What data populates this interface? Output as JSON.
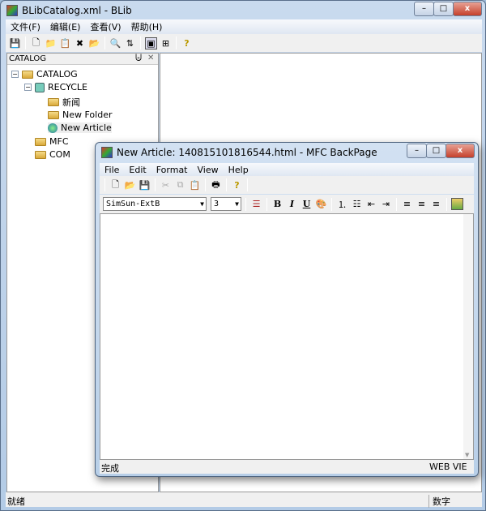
{
  "main": {
    "title": "BLibCatalog.xml - BLib",
    "menu": [
      "文件(F)",
      "编辑(E)",
      "查看(V)",
      "帮助(H)"
    ],
    "catalog_pane": {
      "title": "CATALOG",
      "pin": "⨄",
      "close": "✕"
    },
    "tree": [
      {
        "label": "CATALOG"
      },
      {
        "label": "RECYCLE"
      },
      {
        "label": "新闻"
      },
      {
        "label": "New Folder"
      },
      {
        "label": "New Article"
      },
      {
        "label": "MFC"
      },
      {
        "label": "COM"
      }
    ],
    "status": {
      "left": "就绪",
      "num": "数字"
    }
  },
  "child": {
    "title": "New Article: 140815101816544.html - MFC BackPage",
    "menu": [
      "File",
      "Edit",
      "Format",
      "View",
      "Help"
    ],
    "font": "SimSun-ExtB",
    "size": "3",
    "status_left": "完成",
    "status_right": "WEB VIE"
  },
  "caption": {
    "min": "–",
    "max": "□",
    "close": "x"
  }
}
